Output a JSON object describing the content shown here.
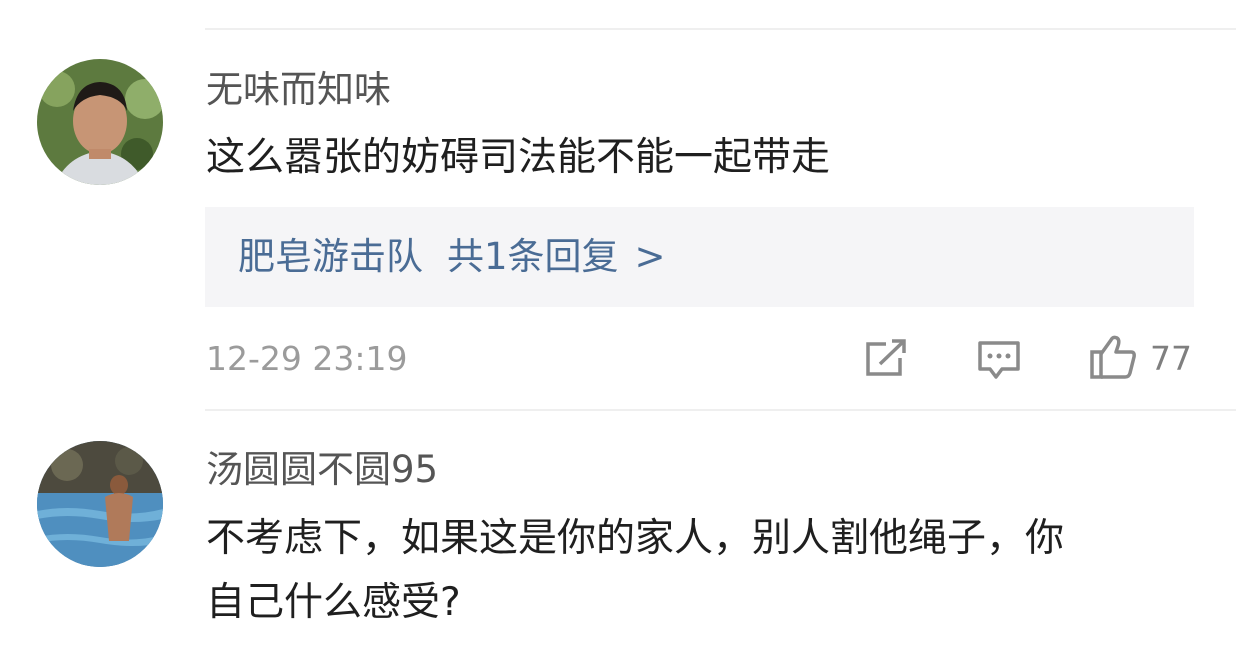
{
  "comments": [
    {
      "username": "无味而知味",
      "content": "这么嚣张的妨碍司法能不能一起带走",
      "reply": {
        "replier": "肥皂游击队",
        "count_text": "共1条回复",
        "arrow": ">"
      },
      "timestamp": "12-29 23:19",
      "likes": "77",
      "icons": [
        "share-icon",
        "comment-icon",
        "thumbs-up-icon"
      ]
    },
    {
      "username": "汤圆圆不圆95",
      "content_lines": [
        "不考虑下，如果这是你的家人，别人割他绳子，你",
        "自己什么感受?"
      ]
    }
  ]
}
